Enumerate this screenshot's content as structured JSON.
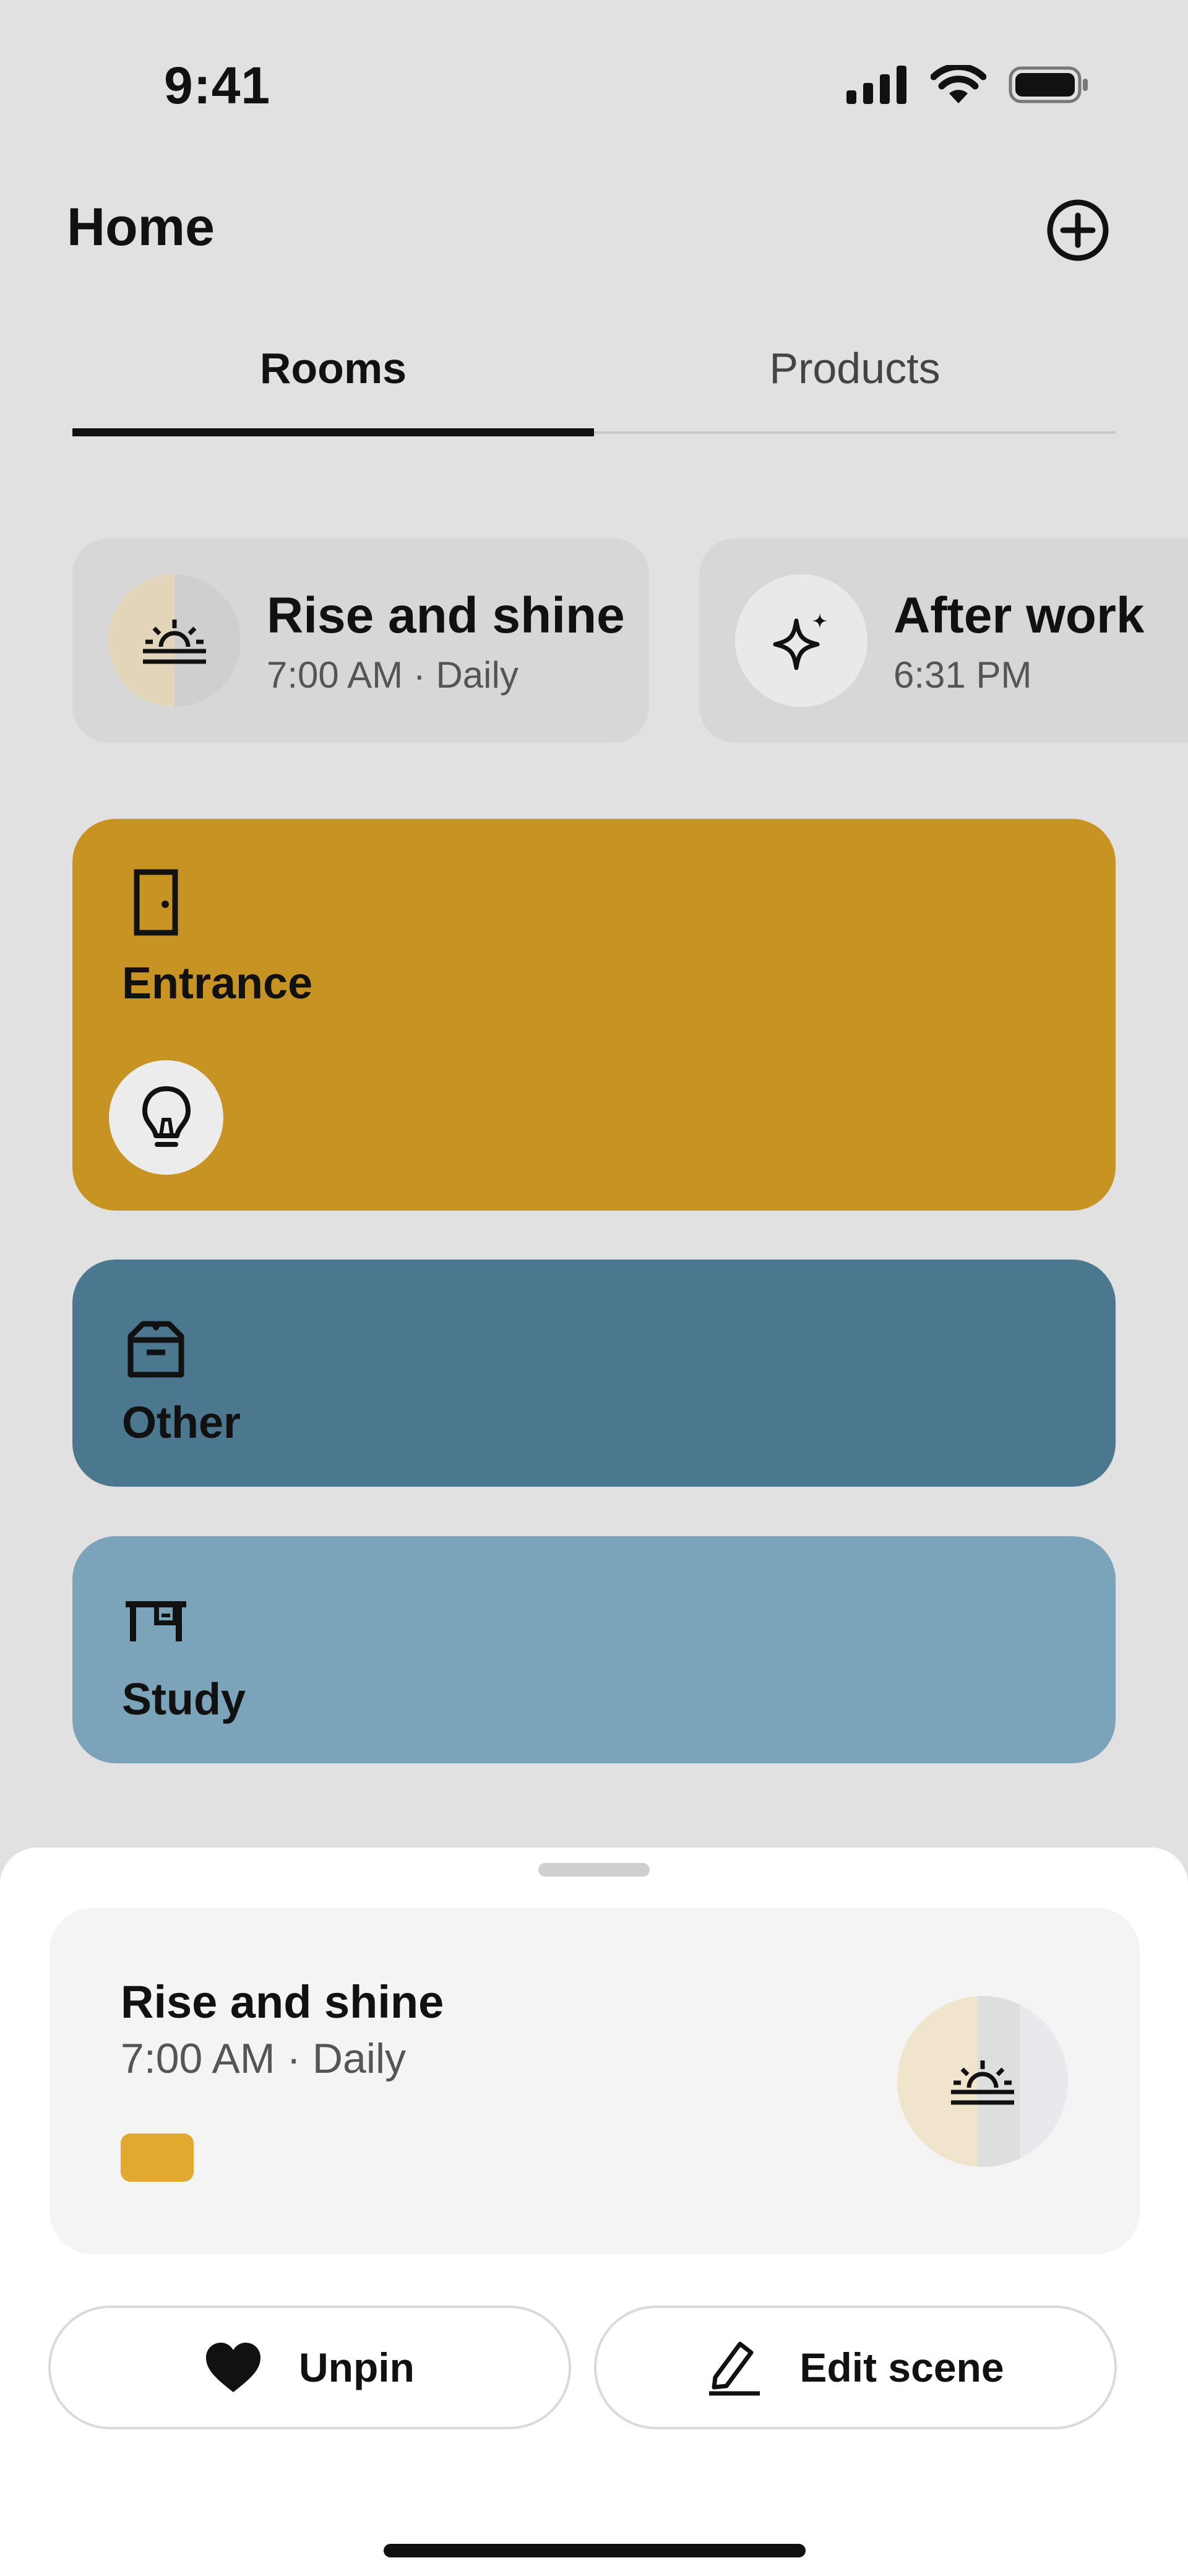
{
  "status_bar": {
    "time": "9:41"
  },
  "header": {
    "title": "Home"
  },
  "tabs": [
    {
      "label": "Rooms",
      "active": true
    },
    {
      "label": "Products",
      "active": false
    }
  ],
  "scenes": [
    {
      "name": "Rise and shine",
      "schedule": "7:00 AM · Daily",
      "icon": "sunrise-icon"
    },
    {
      "name": "After work",
      "schedule": "6:31 PM",
      "icon": "sparkle-icon"
    }
  ],
  "rooms": [
    {
      "name": "Entrance",
      "icon": "door-icon",
      "color": "#c79424",
      "device_icon": "lightbulb-icon"
    },
    {
      "name": "Other",
      "icon": "box-icon",
      "color": "#4b778f"
    },
    {
      "name": "Study",
      "icon": "desk-icon",
      "color": "#7ba3b9"
    }
  ],
  "sheet": {
    "scene_name": "Rise and shine",
    "scene_schedule": "7:00 AM · Daily",
    "swatch_color": "#e1a92f",
    "unpin_label": "Unpin",
    "edit_label": "Edit scene"
  }
}
